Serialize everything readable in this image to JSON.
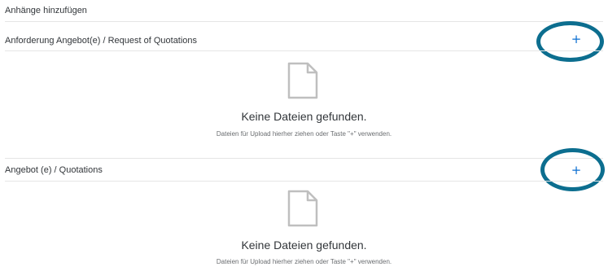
{
  "page": {
    "title": "Anhänge hinzufügen"
  },
  "sections": [
    {
      "title": "Anforderung Angebot(e) / Request of Quotations",
      "add_label": "+",
      "empty_title": "Keine Dateien gefunden.",
      "empty_hint": "Dateien für Upload hierher ziehen oder Taste \"+\" verwenden.",
      "icon": "document-icon"
    },
    {
      "title": "Angebot (e) / Quotations",
      "add_label": "+",
      "empty_title": "Keine Dateien gefunden.",
      "empty_hint": "Dateien für Upload hierher ziehen oder Taste \"+\" verwenden.",
      "icon": "document-icon"
    }
  ],
  "colors": {
    "accent": "#0a6ed1",
    "annotation_ring": "#0c6e8f",
    "icon_gray": "#bfbfbf",
    "divider": "#e5e5e5"
  }
}
